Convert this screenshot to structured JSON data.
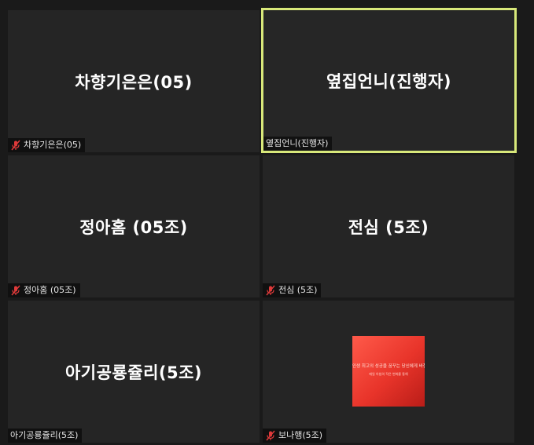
{
  "tiles": [
    {
      "big_name": "차향기은은(05)",
      "tag": "차향기은은(05)",
      "muted": true
    },
    {
      "big_name": "옆집언니(진행자)",
      "tag": "옆집언니(진행자)",
      "muted": false,
      "active": true
    },
    {
      "big_name": "정아홈 (05조)",
      "tag": "정아홈 (05조)",
      "muted": true
    },
    {
      "big_name": "전심 (5조)",
      "tag": "전심 (5조)",
      "muted": true
    },
    {
      "big_name": "아기공룡쥴리(5조)",
      "tag": "아기공룡쥴리(5조)",
      "muted": false
    },
    {
      "tag": "보나행(5조)",
      "muted": true,
      "thumbnail": {
        "line1": "인생 최고의 성공을 꿈꾸는 당신에게 바칩니다",
        "line2": "매일 아침의 작은 변화를 통해"
      }
    }
  ],
  "colors": {
    "active_border": "#d8e87a",
    "mute_red": "#e03a3a",
    "tile_bg": "#252525"
  },
  "icons": {
    "mute": "mic-muted-icon"
  }
}
